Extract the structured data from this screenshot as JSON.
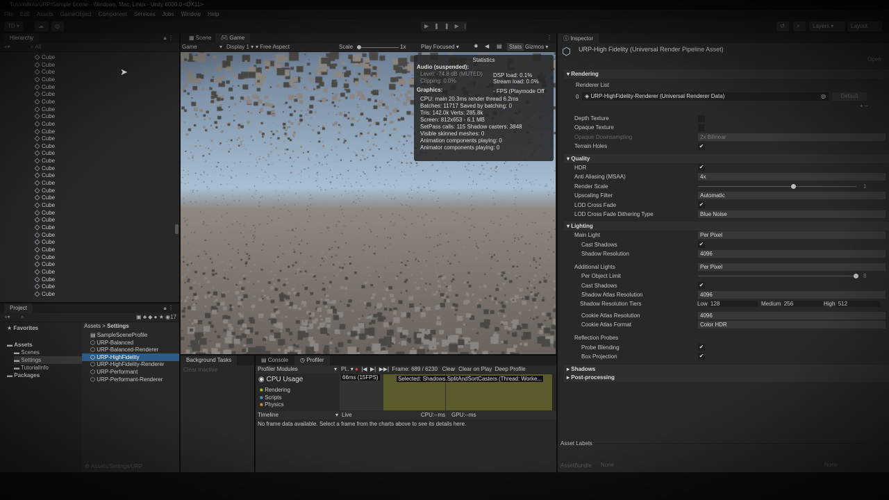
{
  "window": {
    "title": "TutorialInfo/URP/Sample Scene - Windows, Mac, Linux - Unity 6000.0 <DX11>"
  },
  "menu": [
    "File",
    "Edit",
    "Assets",
    "GameObject",
    "Component",
    "Services",
    "Jobs",
    "Window",
    "Help"
  ],
  "toolbar": {
    "account": "TD ▾",
    "layers": "Layers",
    "layout": "Layout"
  },
  "hierarchy": {
    "title": "Hierarchy",
    "search": "All",
    "items": [
      "Cube",
      "Cube",
      "Cube",
      "Cube",
      "Cube",
      "Cube",
      "Cube",
      "Cube",
      "Cube",
      "Cube",
      "Cube",
      "Cube",
      "Cube",
      "Cube",
      "Cube",
      "Cube",
      "Cube",
      "Cube",
      "Cube",
      "Cube",
      "Cube",
      "Cube",
      "Cube",
      "Cube",
      "Cube",
      "Cube",
      "Cube",
      "Cube",
      "Cube",
      "Cube",
      "Cube",
      "Cube",
      "Cube"
    ]
  },
  "project": {
    "title": "Project",
    "hidden_count": "17",
    "tree": [
      {
        "label": "Favorites",
        "level": 0
      },
      {
        "label": "Assets",
        "level": 0
      },
      {
        "label": "Scenes",
        "level": 1
      },
      {
        "label": "Settings",
        "level": 1
      },
      {
        "label": "TutorialInfo",
        "level": 1
      },
      {
        "label": "Packages",
        "level": 0
      }
    ],
    "breadcrumb": [
      "Assets",
      "Settings"
    ],
    "files": [
      "SampleSceneProfile",
      "URP-Balanced",
      "URP-Balanced-Renderer",
      "URP-HighFidelity",
      "URP-HighFidelity-Renderer",
      "URP-Performant",
      "URP-Performant-Renderer"
    ],
    "selected_index": 3,
    "path": "Assets/Settings/URP"
  },
  "game": {
    "tabs": [
      "Scene",
      "Game"
    ],
    "mode": "Game",
    "display": "Display 1",
    "aspect": "Free Aspect",
    "scale_label": "Scale",
    "scale_value": "1x",
    "play_mode": "Play Focused",
    "stats": "Stats",
    "gizmos": "Gizmos"
  },
  "stats": {
    "title": "Statistics",
    "audio_header": "Audio (suspended):",
    "level": "Level: -74.8 dB (MUTED)",
    "clipping": "Clipping: 0.0%",
    "dsp": "DSP load: 0.1%",
    "stream": "Stream load: 0.0%",
    "graphics_header": "Graphics:",
    "fps": "- FPS (Playmode Off",
    "lines": [
      "CPU: main 20.3ms  render thread 6.2ms",
      "Batches: 11717  Saved by batching: 0",
      "Tris: 142.0k       Verts: 285.8k",
      "Screen: 812x653 - 6.1 MB",
      "SetPass calls: 115        Shadow casters: 3848",
      "Visible skinned meshes: 0",
      "Animation components playing: 0",
      "Animator components playing: 0"
    ]
  },
  "background_tasks": {
    "title": "Background Tasks",
    "clear": "Clear Inactive"
  },
  "profiler": {
    "tabs": [
      "Console",
      "Profiler"
    ],
    "modules": "Profiler Modules",
    "target": "Pl..",
    "frame": "Frame: 689 / 6230",
    "clear": "Clear",
    "clear_on_play": "Clear on Play",
    "deep_profile": "Deep Profile",
    "cpu_usage": "CPU Usage",
    "legend": [
      {
        "label": "Rendering",
        "color": "#9bbb3a"
      },
      {
        "label": "Scripts",
        "color": "#3a9bbb"
      },
      {
        "label": "Physics",
        "color": "#d08a2a"
      }
    ],
    "fps_label": "66ms (15FPS)",
    "selected": "Selected: Shadows.SplitAndSortCasters (Thread: Worke...",
    "view": "Timeline",
    "live": "Live",
    "cpu": "CPU:--ms",
    "gpu": "GPU:--ms",
    "no_data": "No frame data available. Select a frame from the charts above to see its details here."
  },
  "inspector": {
    "title": "Inspector",
    "asset": "URP-High Fidelity (Universal Render Pipeline Asset)",
    "open": "Open",
    "rendering": {
      "header": "Rendering",
      "renderer_list": "Renderer List",
      "index": "0",
      "renderer": "URP-HighFidelity-Renderer (Universal Renderer Data)",
      "default": "Default",
      "depth": "Depth Texture",
      "opaque": "Opaque Texture",
      "downsampling": "Opaque Downsampling",
      "downsampling_value": "2x Bilinear",
      "terrain": "Terrain Holes"
    },
    "quality": {
      "header": "Quality",
      "hdr": "HDR",
      "msaa": "Anti Aliasing (MSAA)",
      "msaa_value": "4x",
      "render_scale": "Render Scale",
      "render_scale_value": "1",
      "render_scale_fraction": 0.6,
      "upscaling": "Upscaling Filter",
      "upscaling_value": "Automatic",
      "lod": "LOD Cross Fade",
      "lod_type": "LOD Cross Fade Dithering Type",
      "lod_type_value": "Blue Noise"
    },
    "lighting": {
      "header": "Lighting",
      "main": "Main Light",
      "main_value": "Per Pixel",
      "cast": "Cast Shadows",
      "shadow_res": "Shadow Resolution",
      "shadow_res_value": "4096",
      "additional": "Additional Lights",
      "additional_value": "Per Pixel",
      "per_object": "Per Object Limit",
      "per_object_value": "8",
      "per_object_fraction": 1.0,
      "cast2": "Cast Shadows",
      "atlas": "Shadow Atlas Resolution",
      "atlas_value": "4096",
      "tiers": "Shadow Resolution Tiers",
      "low": "Low",
      "low_v": "128",
      "medium": "Medium",
      "medium_v": "256",
      "high": "High",
      "high_v": "512",
      "cookie_res": "Cookie Atlas Resolution",
      "cookie_res_value": "4096",
      "cookie_fmt": "Cookie Atlas Format",
      "cookie_fmt_value": "Color HDR",
      "probes": "Reflection Probes",
      "blending": "Probe Blending",
      "box": "Box Projection"
    },
    "shadows": "Shadows",
    "post": "Post-processing",
    "asset_labels": "Asset Labels",
    "assetbundle": "AssetBundle",
    "none1": "None",
    "none2": "None"
  }
}
